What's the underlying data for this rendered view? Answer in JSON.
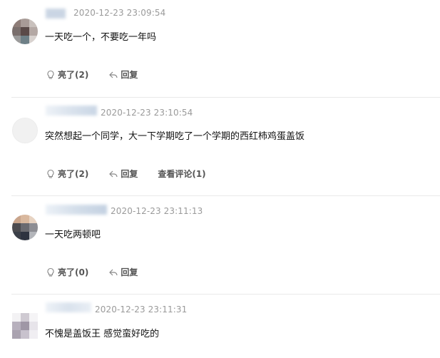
{
  "comments": [
    {
      "time": "2020-12-23 23:09:54",
      "text": "一天吃一个，不要吃一年吗",
      "like_label": "亮了(2)",
      "reply_label": "回复",
      "view_replies_label": ""
    },
    {
      "time": "2020-12-23 23:10:54",
      "text": "突然想起一个同学，大一下学期吃了一个学期的西红柿鸡蛋盖饭",
      "like_label": "亮了(2)",
      "reply_label": "回复",
      "view_replies_label": "查看评论(1)"
    },
    {
      "time": "2020-12-23 23:11:13",
      "text": "一天吃两顿吧",
      "like_label": "亮了(0)",
      "reply_label": "回复",
      "view_replies_label": ""
    },
    {
      "time": "2020-12-23 23:11:31",
      "text": "不愧是盖饭王 感觉蛮好吃的",
      "like_label": "",
      "reply_label": "",
      "view_replies_label": ""
    }
  ],
  "icons": {
    "like": "lightbulb-icon",
    "reply": "reply-arrow-icon"
  },
  "colors": {
    "time": "#9a9a9a",
    "action": "#555555",
    "divider": "#e9e9e9"
  }
}
